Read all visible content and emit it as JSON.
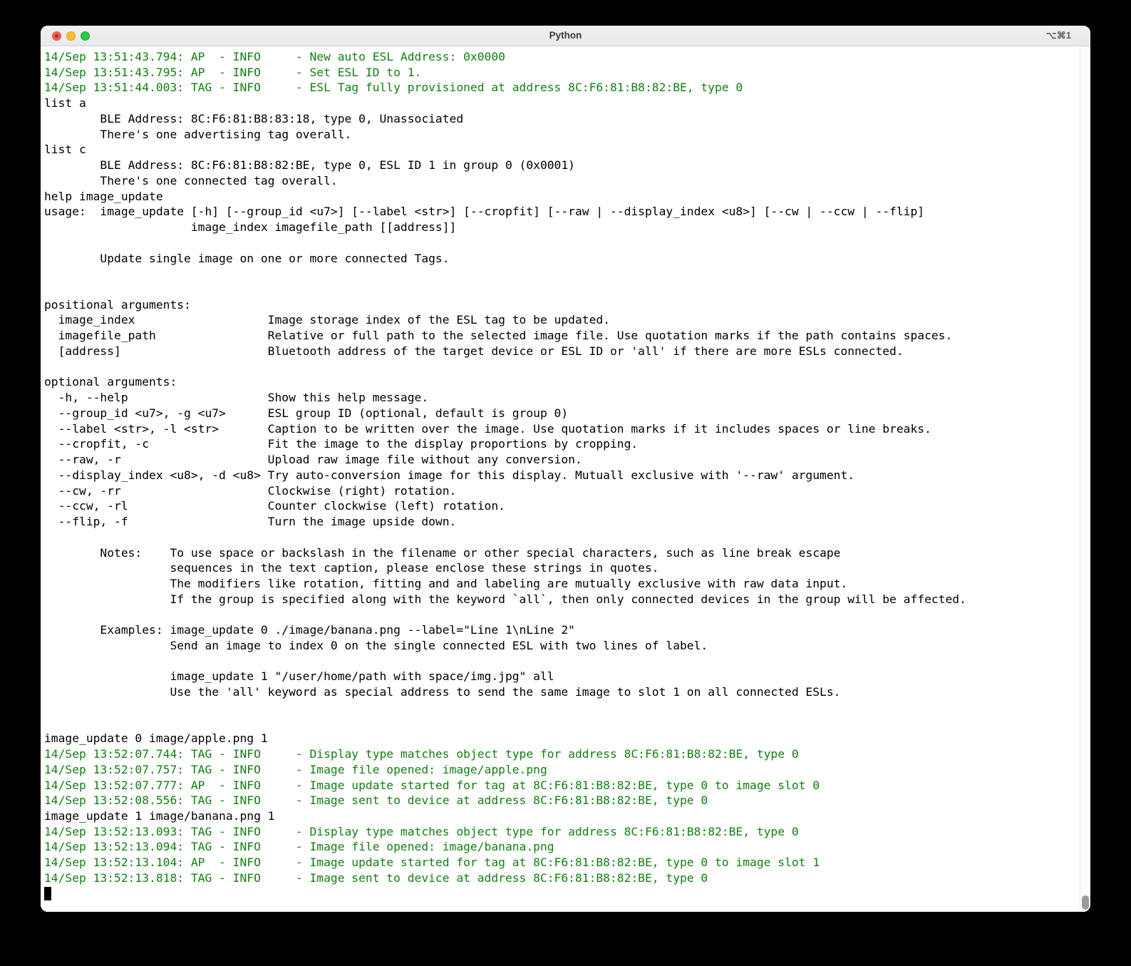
{
  "window": {
    "title": "Python",
    "shortcut_hint": "⌥⌘1"
  },
  "colors": {
    "log_green": "#128012",
    "command_black": "#000000",
    "traffic_close": "#ff5f57",
    "traffic_minimize": "#febc2e",
    "traffic_zoom": "#28c840"
  },
  "terminal": {
    "lines": [
      {
        "type": "log",
        "text": "14/Sep 13:51:43.794: AP  - INFO     - New auto ESL Address: 0x0000"
      },
      {
        "type": "log",
        "text": "14/Sep 13:51:43.795: AP  - INFO     - Set ESL ID to 1."
      },
      {
        "type": "log",
        "text": "14/Sep 13:51:44.003: TAG - INFO     - ESL Tag fully provisioned at address 8C:F6:81:B8:82:BE, type 0"
      },
      {
        "type": "cmd",
        "text": "list a"
      },
      {
        "type": "cmd",
        "text": "        BLE Address: 8C:F6:81:B8:83:18, type 0, Unassociated"
      },
      {
        "type": "cmd",
        "text": "        There's one advertising tag overall."
      },
      {
        "type": "cmd",
        "text": "list c"
      },
      {
        "type": "cmd",
        "text": "        BLE Address: 8C:F6:81:B8:82:BE, type 0, ESL ID 1 in group 0 (0x0001)"
      },
      {
        "type": "cmd",
        "text": "        There's one connected tag overall."
      },
      {
        "type": "cmd",
        "text": "help image_update"
      },
      {
        "type": "cmd",
        "text": "usage:  image_update [-h] [--group_id <u7>] [--label <str>] [--cropfit] [--raw | --display_index <u8>] [--cw | --ccw | --flip]"
      },
      {
        "type": "cmd",
        "text": "                     image_index imagefile_path [[address]]"
      },
      {
        "type": "blank",
        "text": ""
      },
      {
        "type": "cmd",
        "text": "        Update single image on one or more connected Tags."
      },
      {
        "type": "blank",
        "text": ""
      },
      {
        "type": "blank",
        "text": ""
      },
      {
        "type": "cmd",
        "text": "positional arguments:"
      },
      {
        "type": "cmd",
        "text": "  image_index                   Image storage index of the ESL tag to be updated."
      },
      {
        "type": "cmd",
        "text": "  imagefile_path                Relative or full path to the selected image file. Use quotation marks if the path contains spaces."
      },
      {
        "type": "cmd",
        "text": "  [address]                     Bluetooth address of the target device or ESL ID or 'all' if there are more ESLs connected."
      },
      {
        "type": "blank",
        "text": ""
      },
      {
        "type": "cmd",
        "text": "optional arguments:"
      },
      {
        "type": "cmd",
        "text": "  -h, --help                    Show this help message."
      },
      {
        "type": "cmd",
        "text": "  --group_id <u7>, -g <u7>      ESL group ID (optional, default is group 0)"
      },
      {
        "type": "cmd",
        "text": "  --label <str>, -l <str>       Caption to be written over the image. Use quotation marks if it includes spaces or line breaks."
      },
      {
        "type": "cmd",
        "text": "  --cropfit, -c                 Fit the image to the display proportions by cropping."
      },
      {
        "type": "cmd",
        "text": "  --raw, -r                     Upload raw image file without any conversion."
      },
      {
        "type": "cmd",
        "text": "  --display_index <u8>, -d <u8> Try auto-conversion image for this display. Mutuall exclusive with '--raw' argument."
      },
      {
        "type": "cmd",
        "text": "  --cw, -rr                     Clockwise (right) rotation."
      },
      {
        "type": "cmd",
        "text": "  --ccw, -rl                    Counter clockwise (left) rotation."
      },
      {
        "type": "cmd",
        "text": "  --flip, -f                    Turn the image upside down."
      },
      {
        "type": "blank",
        "text": ""
      },
      {
        "type": "cmd",
        "text": "        Notes:    To use space or backslash in the filename or other special characters, such as line break escape"
      },
      {
        "type": "cmd",
        "text": "                  sequences in the text caption, please enclose these strings in quotes."
      },
      {
        "type": "cmd",
        "text": "                  The modifiers like rotation, fitting and and labeling are mutually exclusive with raw data input."
      },
      {
        "type": "cmd",
        "text": "                  If the group is specified along with the keyword `all`, then only connected devices in the group will be affected."
      },
      {
        "type": "blank",
        "text": ""
      },
      {
        "type": "cmd",
        "text": "        Examples: image_update 0 ./image/banana.png --label=\"Line 1\\nLine 2\""
      },
      {
        "type": "cmd",
        "text": "                  Send an image to index 0 on the single connected ESL with two lines of label."
      },
      {
        "type": "blank",
        "text": ""
      },
      {
        "type": "cmd",
        "text": "                  image_update 1 \"/user/home/path with space/img.jpg\" all"
      },
      {
        "type": "cmd",
        "text": "                  Use the 'all' keyword as special address to send the same image to slot 1 on all connected ESLs."
      },
      {
        "type": "blank",
        "text": ""
      },
      {
        "type": "blank",
        "text": ""
      },
      {
        "type": "cmd",
        "text": "image_update 0 image/apple.png 1"
      },
      {
        "type": "log",
        "text": "14/Sep 13:52:07.744: TAG - INFO     - Display type matches object type for address 8C:F6:81:B8:82:BE, type 0"
      },
      {
        "type": "log",
        "text": "14/Sep 13:52:07.757: TAG - INFO     - Image file opened: image/apple.png"
      },
      {
        "type": "log",
        "text": "14/Sep 13:52:07.777: AP  - INFO     - Image update started for tag at 8C:F6:81:B8:82:BE, type 0 to image slot 0"
      },
      {
        "type": "log",
        "text": "14/Sep 13:52:08.556: TAG - INFO     - Image sent to device at address 8C:F6:81:B8:82:BE, type 0"
      },
      {
        "type": "cmd",
        "text": "image_update 1 image/banana.png 1"
      },
      {
        "type": "log",
        "text": "14/Sep 13:52:13.093: TAG - INFO     - Display type matches object type for address 8C:F6:81:B8:82:BE, type 0"
      },
      {
        "type": "log",
        "text": "14/Sep 13:52:13.094: TAG - INFO     - Image file opened: image/banana.png"
      },
      {
        "type": "log",
        "text": "14/Sep 13:52:13.104: AP  - INFO     - Image update started for tag at 8C:F6:81:B8:82:BE, type 0 to image slot 1"
      },
      {
        "type": "log",
        "text": "14/Sep 13:52:13.818: TAG - INFO     - Image sent to device at address 8C:F6:81:B8:82:BE, type 0"
      },
      {
        "type": "cursor",
        "text": ""
      }
    ]
  }
}
